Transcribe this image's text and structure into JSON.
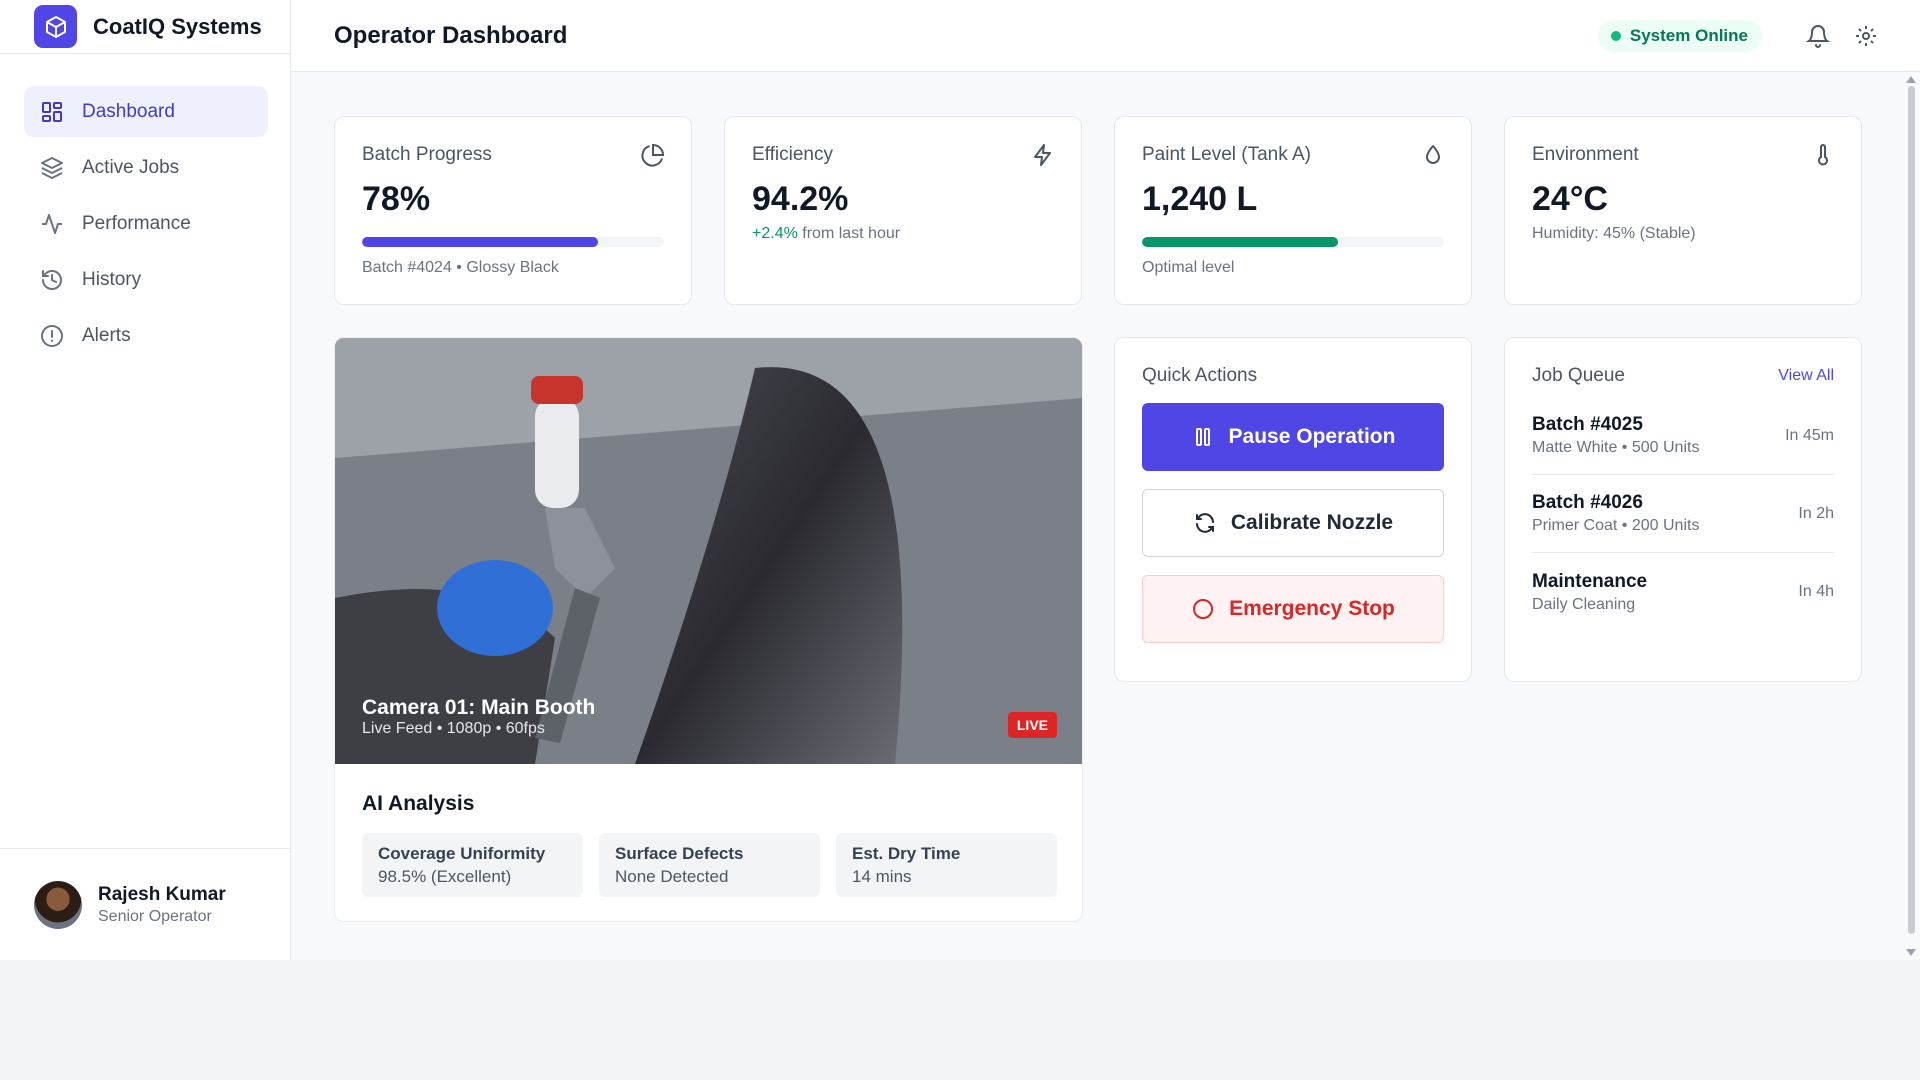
{
  "brand": {
    "name": "CoatIQ Systems"
  },
  "sidebar": {
    "items": [
      {
        "label": "Dashboard",
        "icon": "grid-icon",
        "active": true
      },
      {
        "label": "Active Jobs",
        "icon": "layers-icon"
      },
      {
        "label": "Performance",
        "icon": "activity-icon"
      },
      {
        "label": "History",
        "icon": "history-icon"
      },
      {
        "label": "Alerts",
        "icon": "alert-circle-icon"
      }
    ]
  },
  "user": {
    "name": "Rajesh Kumar",
    "role": "Senior Operator"
  },
  "header": {
    "title": "Operator Dashboard",
    "status": "System Online"
  },
  "stats": {
    "batch": {
      "label": "Batch Progress",
      "value": "78%",
      "progress": 0.78,
      "caption": "Batch #4024 • Glossy Black",
      "color": "#4f46e5"
    },
    "efficiency": {
      "label": "Efficiency",
      "value": "94.2%",
      "delta": "+2.4%",
      "delta_text": "from last hour"
    },
    "paint": {
      "label": "Paint Level (Tank A)",
      "value": "1,240 L",
      "progress": 0.65,
      "caption": "Optimal level",
      "color": "#059669"
    },
    "environment": {
      "label": "Environment",
      "value": "24°C",
      "caption": "Humidity: 45% (Stable)"
    }
  },
  "camera": {
    "title": "Camera 01: Main Booth",
    "meta": "Live Feed • 1080p • 60fps",
    "badge": "LIVE"
  },
  "ai_analysis": {
    "title": "AI Analysis",
    "metrics": [
      {
        "label": "Coverage Uniformity",
        "value": "98.5% (Excellent)"
      },
      {
        "label": "Surface Defects",
        "value": "None Detected"
      },
      {
        "label": "Est. Dry Time",
        "value": "14 mins"
      }
    ]
  },
  "quick_actions": {
    "title": "Quick Actions",
    "pause": "Pause Operation",
    "calibrate": "Calibrate Nozzle",
    "stop": "Emergency Stop"
  },
  "job_queue": {
    "title": "Job Queue",
    "view_all": "View All",
    "items": [
      {
        "title": "Batch #4025",
        "sub": "Matte White • 500 Units",
        "eta": "In 45m"
      },
      {
        "title": "Batch #4026",
        "sub": "Primer Coat • 200 Units",
        "eta": "In 2h"
      },
      {
        "title": "Maintenance",
        "sub": "Daily Cleaning",
        "eta": "In 4h"
      }
    ]
  }
}
